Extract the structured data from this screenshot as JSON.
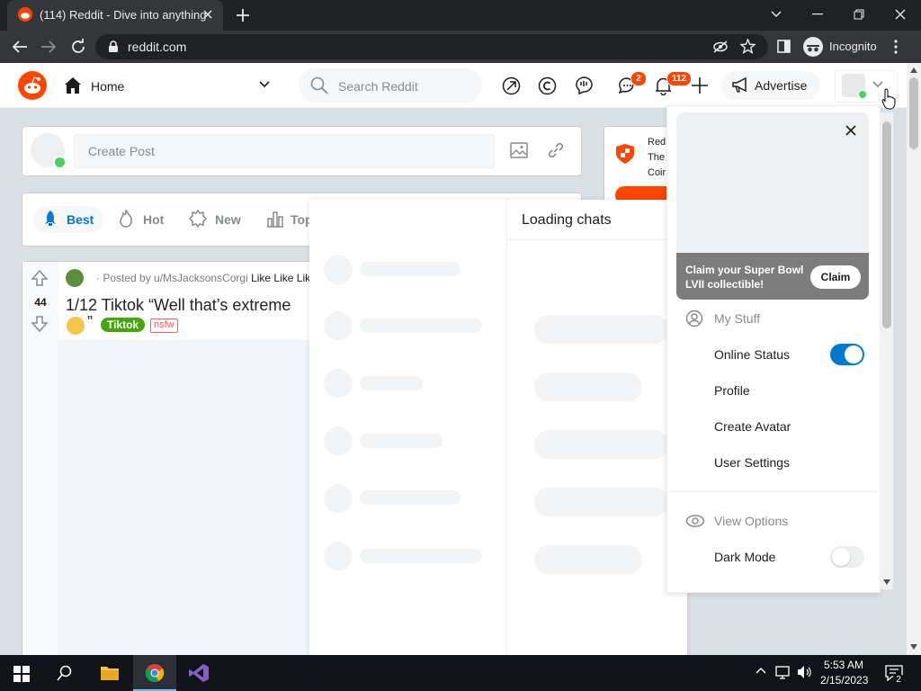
{
  "browser": {
    "tab_title": "(114) Reddit - Dive into anything",
    "url": "reddit.com",
    "incognito_label": "Incognito"
  },
  "header": {
    "home_label": "Home",
    "search_placeholder": "Search Reddit",
    "chat_badge": "2",
    "notifications_badge": "112",
    "advertise_label": "Advertise"
  },
  "create_post": {
    "placeholder": "Create Post"
  },
  "sort_tabs": [
    {
      "label": "Best"
    },
    {
      "label": "Hot"
    },
    {
      "label": "New"
    },
    {
      "label": "Top"
    }
  ],
  "post": {
    "votes": "44",
    "meta": "· Posted by u/MsJacksonsCorgi",
    "meta_extra": "Like Like Like",
    "title": "1/12 Tiktok “Well that’s extreme",
    "title_end": "”",
    "flair": "Tiktok",
    "nsfw": "nsfw"
  },
  "premium_card": {
    "line1": "Red",
    "line2": "The",
    "line3": "Coir"
  },
  "chat": {
    "title": "Loading chats"
  },
  "dropdown": {
    "claim_text": "Claim your Super Bowl LVII collectible!",
    "claim_button": "Claim",
    "my_stuff_label": "My Stuff",
    "online_status_label": "Online Status",
    "online_status_on": true,
    "profile_label": "Profile",
    "create_avatar_label": "Create Avatar",
    "user_settings_label": "User Settings",
    "view_options_label": "View Options",
    "dark_mode_label": "Dark Mode",
    "dark_mode_on": false
  },
  "taskbar": {
    "time": "5:53 AM",
    "date": "2/15/2023",
    "notification_count": "2"
  },
  "colors": {
    "reddit_orange": "#ff4500",
    "accent_blue": "#0079d3",
    "toggle_on": "#0079d3",
    "flair_green": "#46a508"
  }
}
